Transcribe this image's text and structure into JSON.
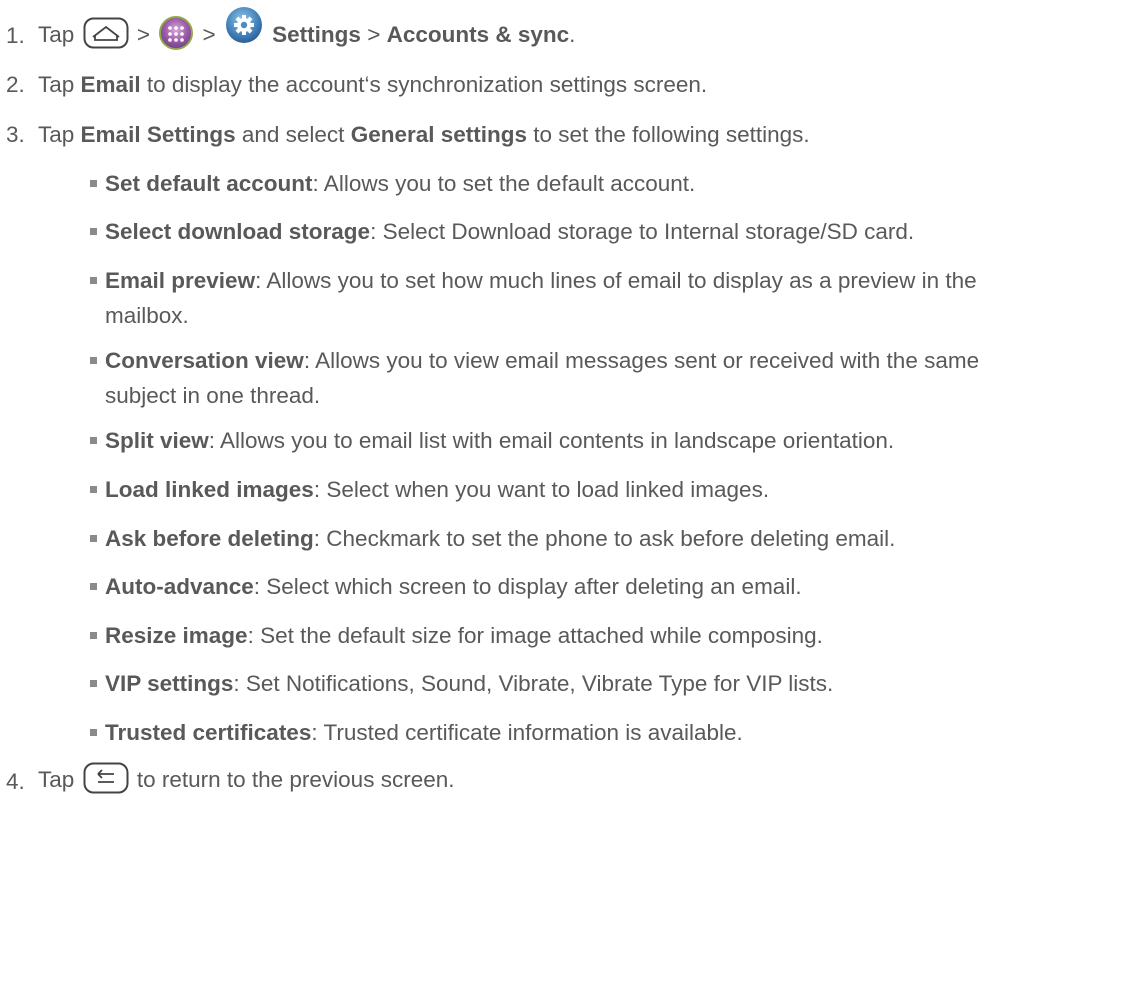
{
  "steps": [
    {
      "number": "1.",
      "tap": "Tap",
      "sep1": ">",
      "sep2": ">",
      "settings": "Settings",
      "sep3": ">",
      "accounts": "Accounts & sync",
      "end": ".",
      "icons": [
        "home-key-icon",
        "apps-icon",
        "settings-gear-icon"
      ]
    },
    {
      "number": "2.",
      "tap": "Tap",
      "bold": "Email",
      "rest": "to display the account‘s synchronization settings screen."
    },
    {
      "number": "3.",
      "tap": "Tap",
      "bold1": "Email Settings",
      "mid": "and select",
      "bold2": "General settings",
      "rest": "to set the following settings."
    },
    {
      "number": "4.",
      "tap": "Tap",
      "rest": "to return to the previous screen.",
      "icons": [
        "back-key-icon"
      ]
    }
  ],
  "bullets": [
    {
      "term": "Set default account",
      "desc": ": Allows you to set the default account."
    },
    {
      "term": "Select download storage",
      "desc": ": Select Download storage to Internal storage/SD card."
    },
    {
      "term": "Email preview",
      "desc": ": Allows you to set how much lines of email to display as a preview in the",
      "desc2": "mailbox."
    },
    {
      "term": "Conversation view",
      "desc": ": Allows you to view email messages sent or received with the same",
      "desc2": "subject in one thread."
    },
    {
      "term": "Split view",
      "desc": ": Allows you to email list with email contents in landscape orientation."
    },
    {
      "term": "Load linked images",
      "desc": ": Select when you want to load linked images."
    },
    {
      "term": "Ask before deleting",
      "desc": ": Checkmark to set the phone to ask before deleting email."
    },
    {
      "term": "Auto-advance",
      "desc": ": Select which screen to display after deleting an email."
    },
    {
      "term": "Resize image",
      "desc": ": Set the default size for image attached while composing."
    },
    {
      "term": "VIP settings",
      "desc": ": Set Notifications, Sound, Vibrate, Vibrate Type for VIP lists."
    },
    {
      "term": "Trusted certificates",
      "desc": ": Trusted certificate information is available."
    }
  ]
}
